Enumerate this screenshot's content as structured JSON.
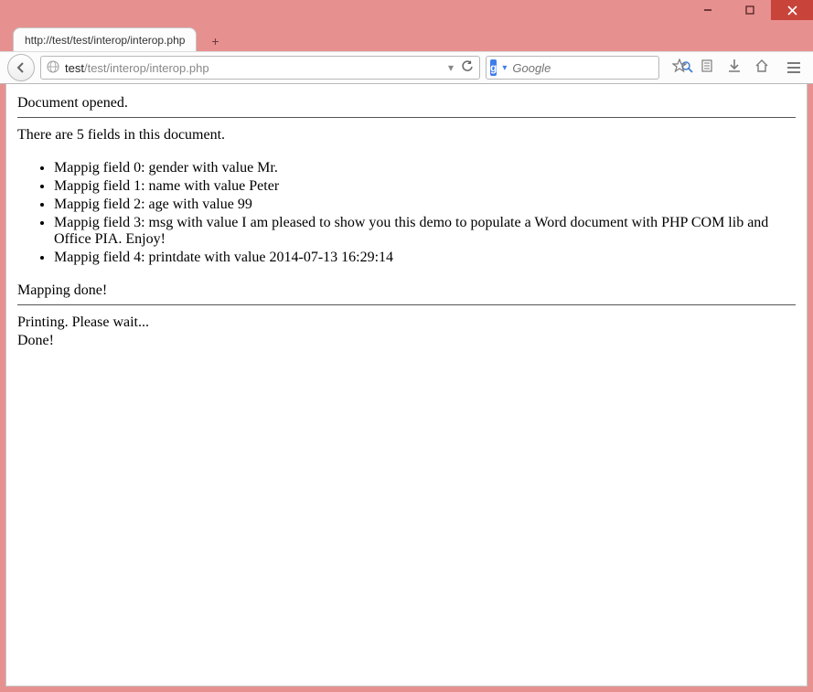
{
  "window": {
    "tab_title": "http://test/test/interop/interop.php"
  },
  "nav": {
    "url_prefix": "test",
    "url_rest": "/test/interop/interop.php",
    "search_placeholder": "Google",
    "search_engine_letter": "g"
  },
  "page": {
    "opened_msg": "Document opened.",
    "field_count_msg": "There are 5 fields in this document.",
    "fields": [
      "Mappig field 0: gender with value Mr.",
      "Mappig field 1: name with value Peter",
      "Mappig field 2: age with value 99",
      "Mappig field 3: msg with value I am pleased to show you this demo to populate a Word document with PHP COM lib and Office PIA. Enjoy!",
      "Mappig field 4: printdate with value 2014-07-13 16:29:14"
    ],
    "mapping_done_msg": "Mapping done!",
    "printing_msg": "Printing. Please wait...",
    "done_msg": "Done!"
  }
}
